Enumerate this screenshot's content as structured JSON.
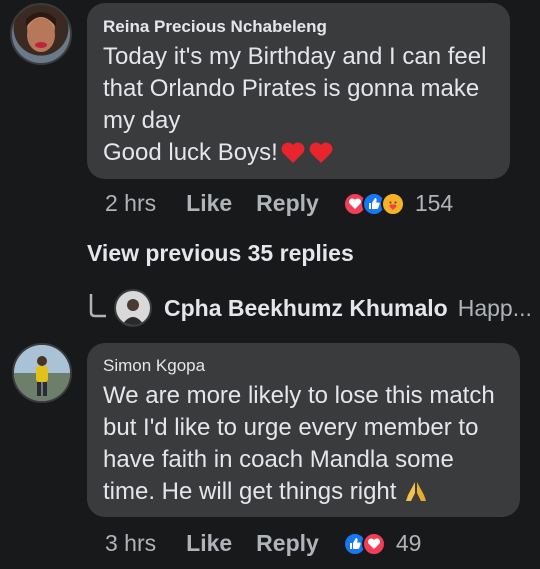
{
  "comment1": {
    "author": "Reina Precious Nchabeleng",
    "text": "Today it's my Birthday and I can feel that Orlando Pirates is gonna make my day\nGood luck Boys!",
    "time": "2 hrs",
    "like_label": "Like",
    "reply_label": "Reply",
    "reactions": [
      "love-icon",
      "like-icon",
      "care-icon"
    ],
    "reaction_count": "154"
  },
  "view_previous": "View previous 35 replies",
  "collapsed_reply": {
    "author": "Cpha Beekhumz Khumalo",
    "snippet": "Happ..."
  },
  "comment2": {
    "author": "Simon Kgopa",
    "text": "We are more likely to lose this match but I'd like to urge every member to have faith in coach Mandla some time. He will get things right",
    "time": "3 hrs",
    "like_label": "Like",
    "reply_label": "Reply",
    "reactions": [
      "like-icon",
      "love-icon"
    ],
    "reaction_count": "49"
  },
  "colors": {
    "background": "#18191a",
    "bubble": "#3a3b3c",
    "love": "#f33e58",
    "like": "#1877f2",
    "care": "#f7b125"
  }
}
